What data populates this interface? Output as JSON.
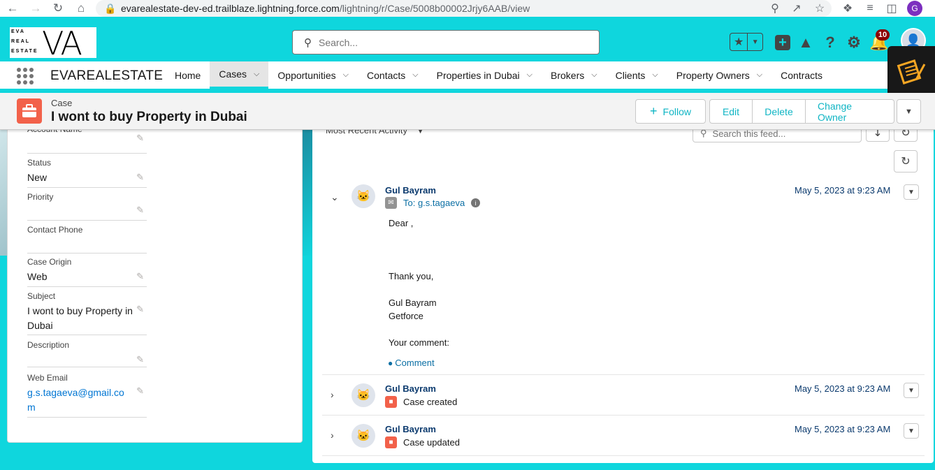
{
  "browser": {
    "url_host": "evarealestate-dev-ed.trailblaze.lightning.force.com",
    "url_path": "/lightning/r/Case/5008b00002Jrjy6AAB/view",
    "profile_initial": "G"
  },
  "header": {
    "logo_lines": [
      "EVA",
      "REAL",
      "ESTATE"
    ],
    "logo_mark": "VA",
    "search_placeholder": "Search...",
    "notification_count": "10"
  },
  "nav": {
    "app_name": "EVAREALESTATE",
    "tabs": [
      {
        "label": "Home",
        "has_menu": false
      },
      {
        "label": "Cases",
        "has_menu": true,
        "active": true
      },
      {
        "label": "Opportunities",
        "has_menu": true
      },
      {
        "label": "Contacts",
        "has_menu": true
      },
      {
        "label": "Properties in Dubai",
        "has_menu": true
      },
      {
        "label": "Brokers",
        "has_menu": true
      },
      {
        "label": "Clients",
        "has_menu": true
      },
      {
        "label": "Property Owners",
        "has_menu": true
      },
      {
        "label": "Contracts",
        "has_menu": true
      }
    ]
  },
  "record": {
    "type": "Case",
    "title": "I wont to buy Property in Dubai",
    "actions": {
      "follow": "Follow",
      "edit": "Edit",
      "delete": "Delete",
      "change_owner": "Change Owner"
    }
  },
  "details": {
    "account_name_label": "Account Name",
    "fields": [
      {
        "label": "Status",
        "value": "New"
      },
      {
        "label": "Priority",
        "value": ""
      },
      {
        "label": "Contact Phone",
        "value": ""
      },
      {
        "label": "Case Origin",
        "value": "Web"
      },
      {
        "label": "Subject",
        "value": "I wont to buy Property in Dubai"
      },
      {
        "label": "Description",
        "value": ""
      },
      {
        "label": "Web Email",
        "value": "g.s.tagaeva@gmail.com"
      }
    ]
  },
  "feed": {
    "filter_label": "Most Recent Activity",
    "search_placeholder": "Search this feed...",
    "items": [
      {
        "author": "Gul Bayram",
        "subtitle": "To: g.s.tagaeva",
        "date": "May 5, 2023 at 9:23 AM",
        "body": [
          "Dear ,",
          "Thank you,",
          "Gul Bayram",
          "Getforce",
          "Your comment:"
        ],
        "comment_label": "Comment"
      },
      {
        "author": "Gul Bayram",
        "subtitle": "Case created",
        "date": "May 5, 2023 at 9:23 AM"
      },
      {
        "author": "Gul Bayram",
        "subtitle": "Case updated",
        "date": "May 5, 2023 at 9:23 AM"
      }
    ]
  },
  "colors": {
    "brand_cyan": "#0fd6dd",
    "case_orange": "#f2614a",
    "link_blue": "#0176d3"
  }
}
